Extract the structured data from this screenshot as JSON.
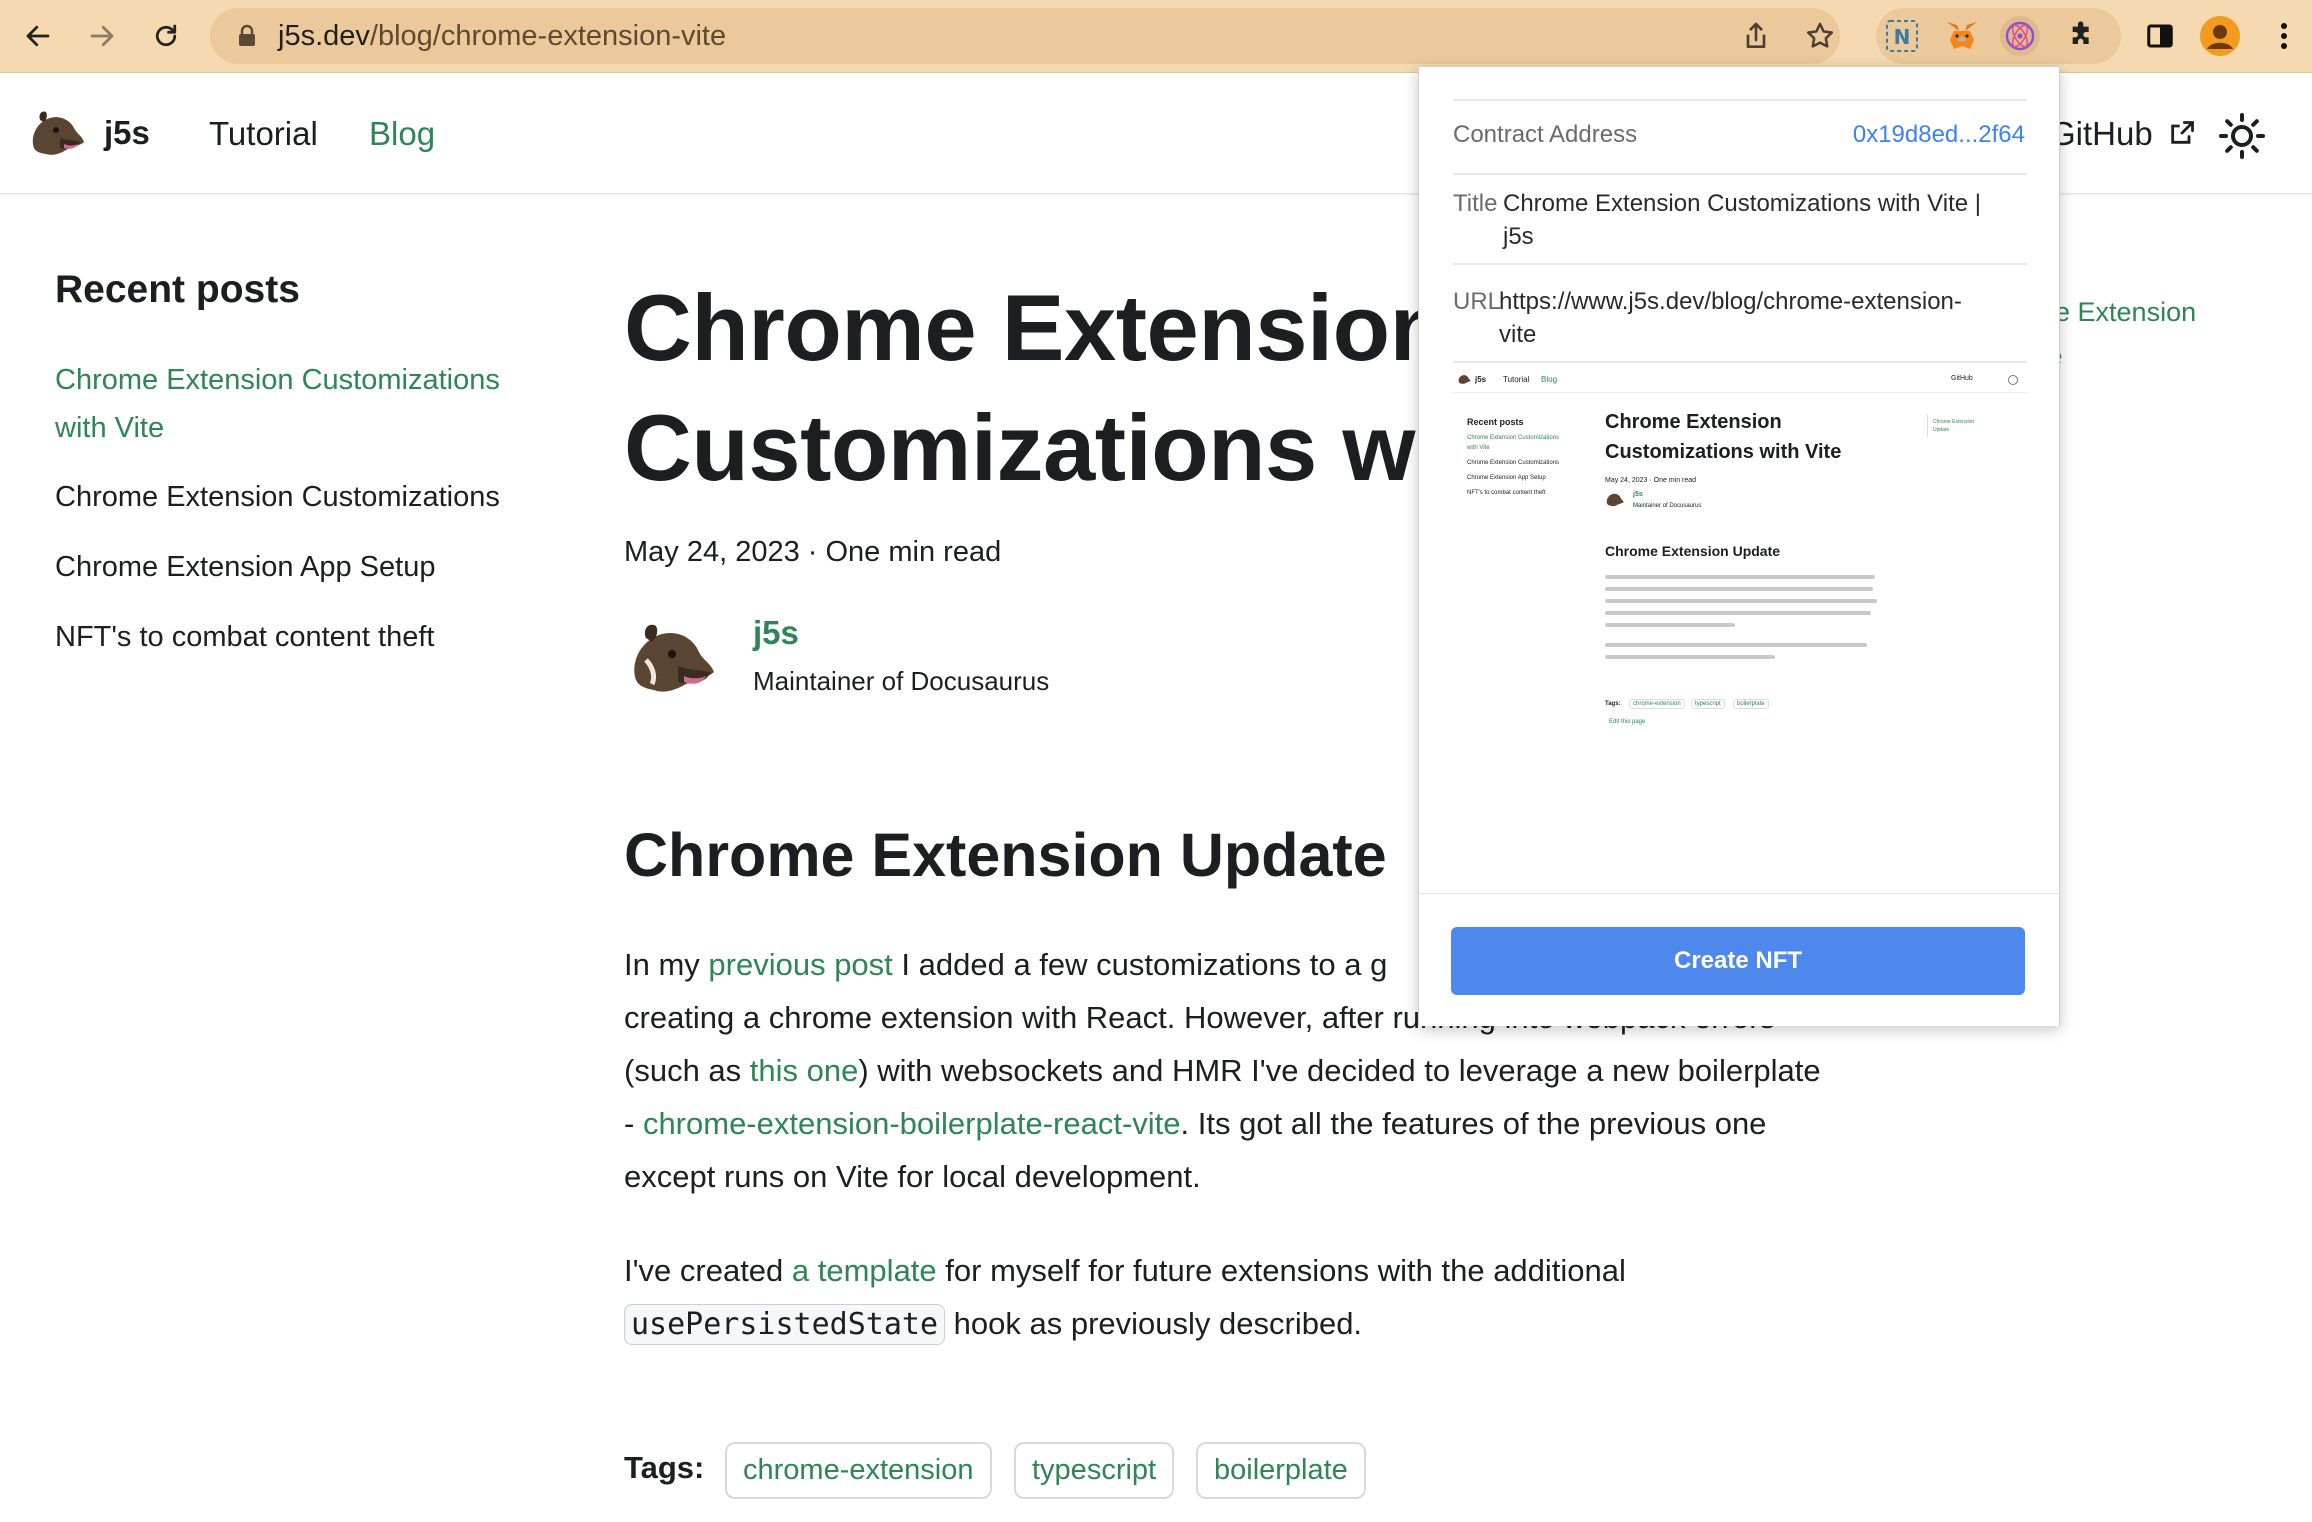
{
  "browser": {
    "url_host": "j5s.dev",
    "url_path": "/blog/chrome-extension-vite"
  },
  "site": {
    "brand": "j5s",
    "nav": {
      "tutorial": "Tutorial",
      "blog": "Blog",
      "github": "GitHub"
    }
  },
  "sidebar": {
    "title": "Recent posts",
    "items": [
      {
        "label_line1": "Chrome Extension Customizations",
        "label_line2": "with Vite"
      },
      {
        "label": "Chrome Extension Customizations"
      },
      {
        "label": "Chrome Extension App Setup"
      },
      {
        "label": "NFT's to combat content theft"
      }
    ]
  },
  "post": {
    "title_line1": "Chrome Extension",
    "title_line2": "Customizations w",
    "meta": "May 24, 2023 · One min read",
    "author": {
      "name": "j5s",
      "title": "Maintainer of Docusaurus"
    },
    "heading": "Chrome Extension Update",
    "p1": {
      "t1": "In my ",
      "link1": "previous post",
      "t2": " I added a few customizations to a g",
      "line2": "creating a chrome extension with React. However, after running into webpack errors",
      "t3": "(such as ",
      "link2": "this one",
      "t4": ") with websockets and HMR I've decided to leverage a new boilerplate",
      "t5": "- ",
      "link3": "chrome-extension-boilerplate-react-vite",
      "t6": ". Its got all the features of the previous one",
      "line5": "except runs on Vite for local development."
    },
    "p2": {
      "t1": "I've created ",
      "link1": "a template",
      "t2": " for myself for future extensions with the additional",
      "code": "usePersistedState",
      "t3": " hook as previously described."
    },
    "tags_label": "Tags:",
    "tags": [
      "chrome-extension",
      "typescript",
      "boilerplate"
    ],
    "toc_fragments": [
      "ne Extension",
      "te"
    ]
  },
  "popup": {
    "contract_label": "Contract Address",
    "contract_value": "0x19d8ed...2f64",
    "title_label": "Title",
    "title_value_line1": "Chrome Extension Customizations with Vite |",
    "title_value_line2": "j5s",
    "url_label": "URL",
    "url_value_line1": "https://www.j5s.dev/blog/chrome-extension-",
    "url_value_line2": "vite",
    "button": "Create NFT",
    "preview": {
      "nav_brand": "j5s",
      "nav_tutorial": "Tutorial",
      "nav_blog": "Blog",
      "nav_github": "GitHub",
      "recent": "Recent posts",
      "side1": "Chrome Extension Customizations",
      "side1b": "with Vite",
      "side2": "Chrome Extension Customizations",
      "side3": "Chrome Extension App Setup",
      "side4": "NFT's to combat content theft",
      "title1": "Chrome Extension",
      "title2": "Customizations with Vite",
      "meta": "May 24, 2023 · One min read",
      "author": "j5s",
      "author_title": "Maintainer of Docusaurus",
      "heading": "Chrome Extension Update",
      "tags_label": "Tags:",
      "tags": [
        "chrome-extension",
        "typescript",
        "boilerplate"
      ],
      "edit": "Edit this page",
      "toc1": "Chrome Extension",
      "toc2": "Update"
    }
  },
  "colors": {
    "accent": "#2e8555",
    "browser_bar": "#f5d9b1",
    "button": "#4d88ec",
    "link_blue": "#3b82f6"
  }
}
